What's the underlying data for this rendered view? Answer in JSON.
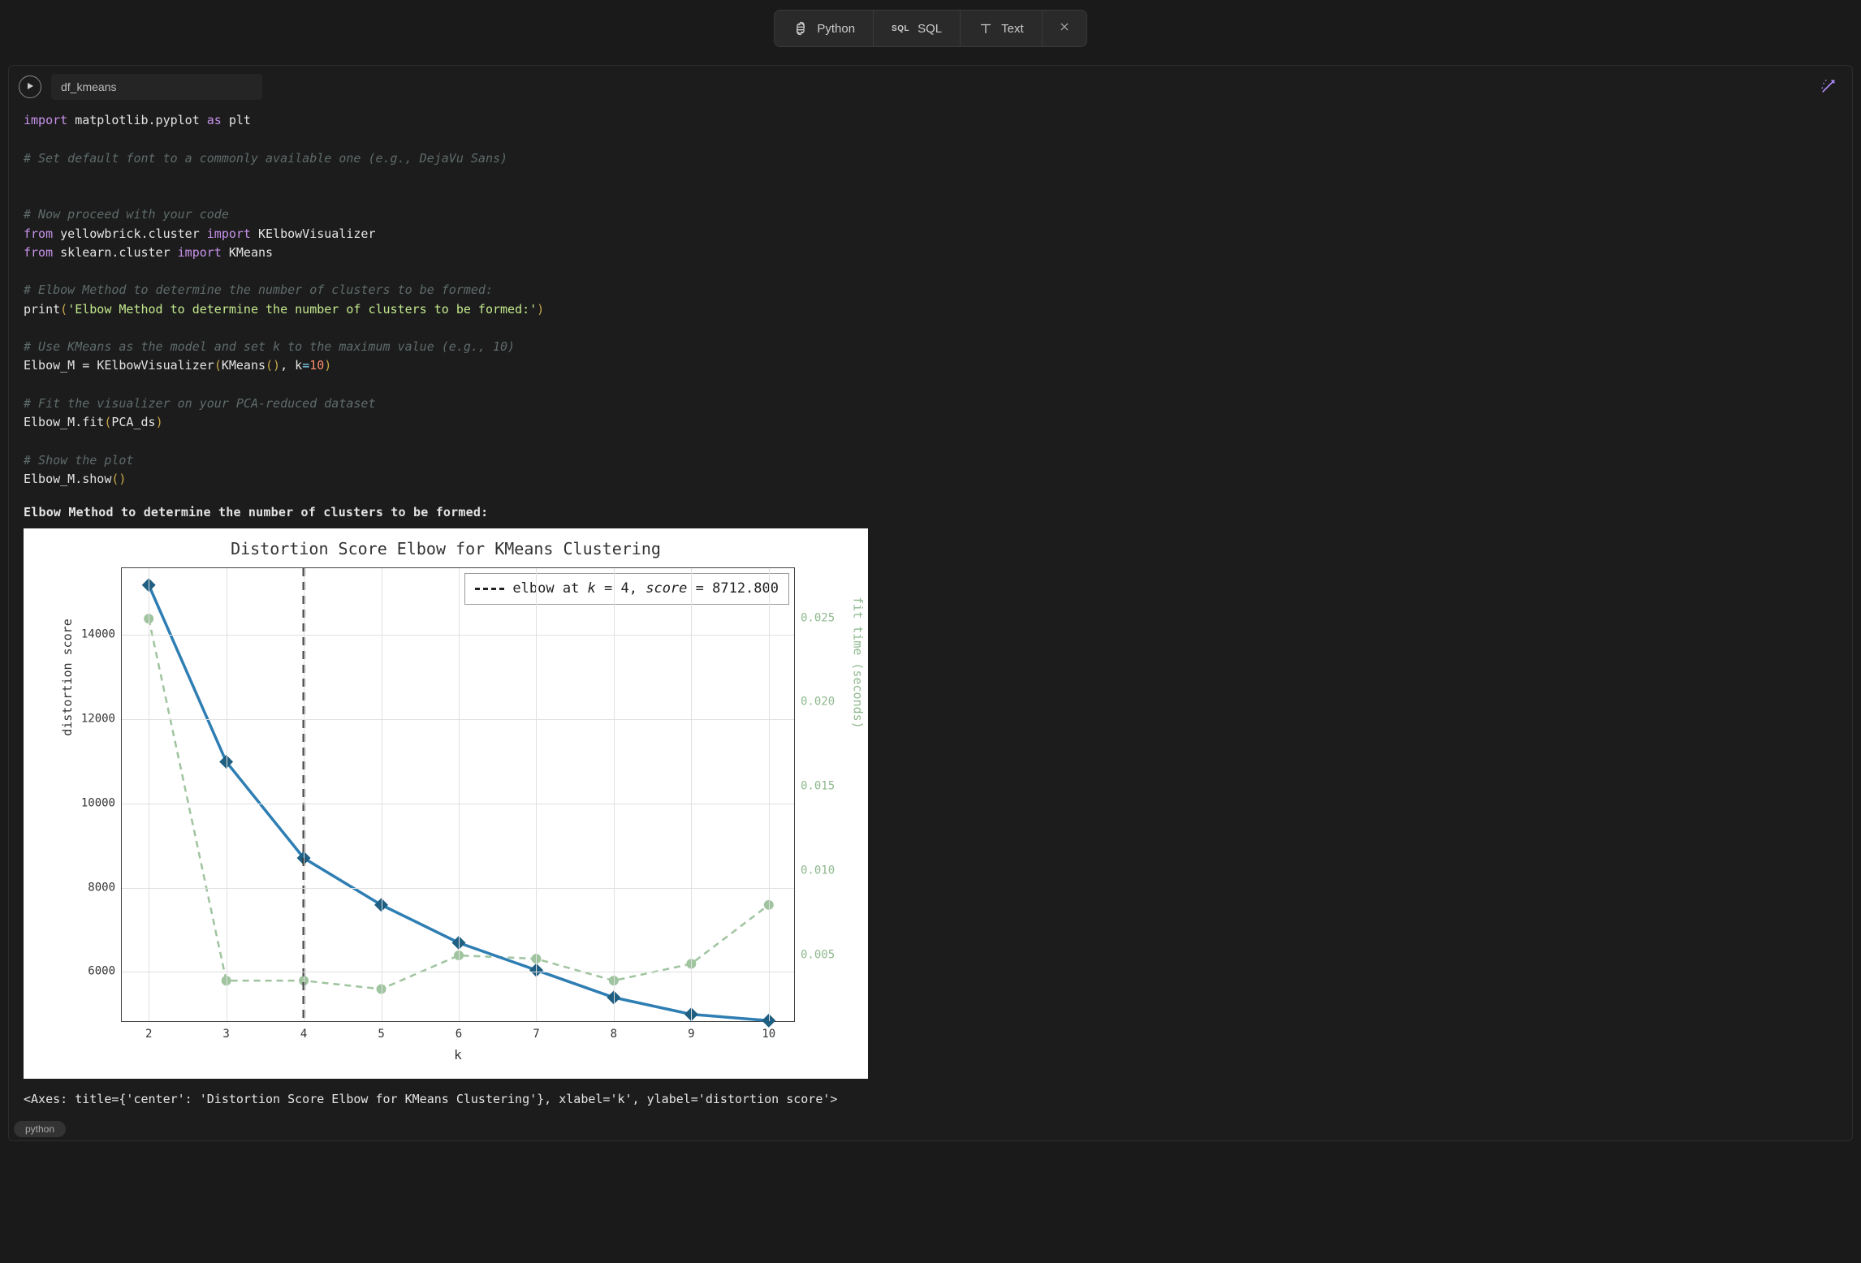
{
  "toolbar": {
    "python": "Python",
    "sql": "SQL",
    "sql_icon_text": "SQL",
    "text": "Text"
  },
  "cell": {
    "name": "df_kmeans",
    "lang_badge": "python"
  },
  "code": {
    "l1_import": "import",
    "l1_mod": "matplotlib.pyplot",
    "l1_as": "as",
    "l1_alias": "plt",
    "c1": "# Set default font to a commonly available one (e.g., DejaVu Sans)",
    "c2": "# Now proceed with your code",
    "l2_from": "from",
    "l2_mod": "yellowbrick.cluster",
    "l2_import": "import",
    "l2_name": "KElbowVisualizer",
    "l3_from": "from",
    "l3_mod": "sklearn.cluster",
    "l3_import": "import",
    "l3_name": "KMeans",
    "c3": "# Elbow Method to determine the number of clusters to be formed:",
    "l4_fn": "print",
    "l4_str": "'Elbow Method to determine the number of clusters to be formed:'",
    "c4": "# Use KMeans as the model and set k to the maximum value (e.g., 10)",
    "l5_lhs": "Elbow_M",
    "l5_eq": " = ",
    "l5_cls": "KElbowVisualizer",
    "l5_kmeans": "KMeans",
    "l5_k": "k",
    "l5_kval": "10",
    "c5": "# Fit the visualizer on your PCA-reduced dataset",
    "l6_obj": "Elbow_M.fit",
    "l6_arg": "PCA_ds",
    "c6": "# Show the plot",
    "l7": "Elbow_M.show"
  },
  "output": {
    "print": "Elbow Method to determine the number of clusters to be formed:",
    "repr": "<Axes: title={'center': 'Distortion Score Elbow for KMeans Clustering'}, xlabel='k', ylabel='distortion score'>"
  },
  "chart": {
    "title": "Distortion Score Elbow for KMeans Clustering",
    "legend": "elbow at k = 4, score = 8712.800",
    "xlabel": "k",
    "ylabel_left": "distortion score",
    "ylabel_right": "fit time (seconds)",
    "yticks_left": [
      "6000",
      "8000",
      "10000",
      "12000",
      "14000"
    ],
    "yticks_right": [
      "0.005",
      "0.010",
      "0.015",
      "0.020",
      "0.025"
    ],
    "xticks": [
      "2",
      "3",
      "4",
      "5",
      "6",
      "7",
      "8",
      "9",
      "10"
    ]
  },
  "chart_data": [
    {
      "type": "line",
      "title": "Distortion Score Elbow for KMeans Clustering",
      "xlabel": "k",
      "x": [
        2,
        3,
        4,
        5,
        6,
        7,
        8,
        9,
        10
      ],
      "series": [
        {
          "name": "distortion score",
          "axis": "left",
          "ylabel": "distortion score",
          "ylim": [
            4800,
            15600
          ],
          "values": [
            15200,
            11000,
            8712.8,
            7600,
            6700,
            6050,
            5400,
            5000,
            4850
          ]
        },
        {
          "name": "fit time (seconds)",
          "axis": "right",
          "ylabel": "fit time (seconds)",
          "ylim": [
            0.001,
            0.028
          ],
          "values": [
            0.025,
            0.0035,
            0.0035,
            0.003,
            0.005,
            0.0048,
            0.0035,
            0.0045,
            0.008
          ]
        }
      ],
      "annotations": [
        {
          "type": "vline",
          "x": 4,
          "style": "dashed",
          "label": "elbow at k = 4, score = 8712.800"
        }
      ],
      "legend_position": "upper right"
    }
  ]
}
